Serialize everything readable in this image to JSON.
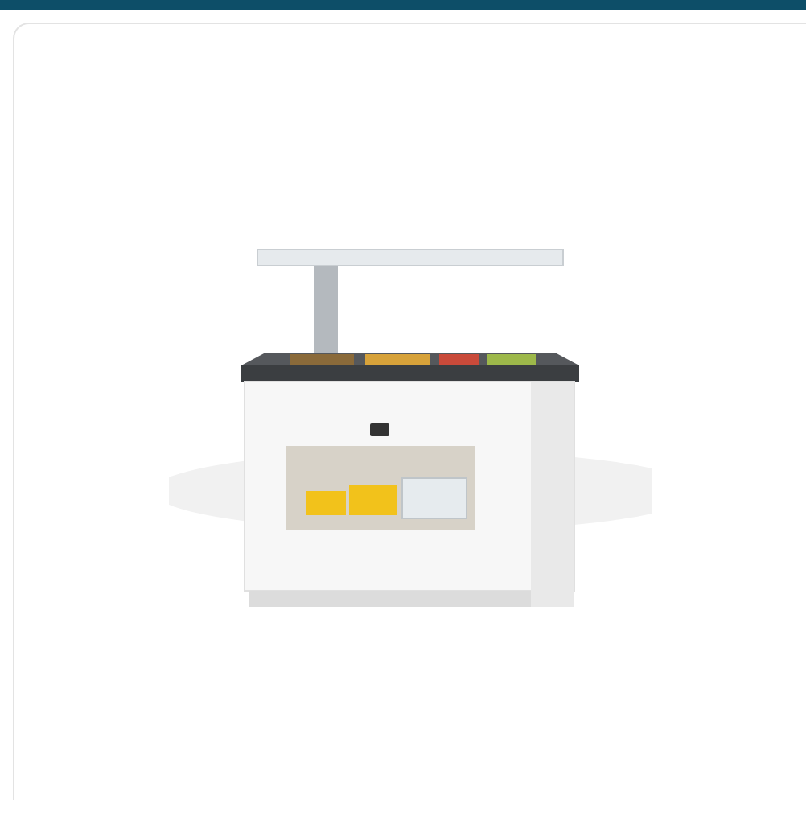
{
  "product_image": {
    "kind": "photo"
  }
}
